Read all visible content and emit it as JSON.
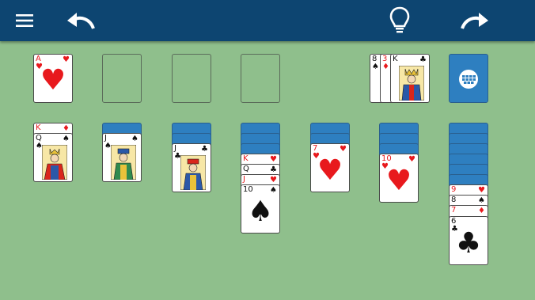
{
  "toolbar": {
    "background": "#0d4571",
    "buttons": [
      {
        "name": "menu",
        "icon": "hamburger-icon"
      },
      {
        "name": "undo",
        "icon": "undo-arrow-icon"
      },
      {
        "name": "hint",
        "icon": "lightbulb-icon"
      },
      {
        "name": "redo",
        "icon": "redo-arrow-icon"
      }
    ]
  },
  "table_background": "#8fbf8c",
  "foundations": [
    {
      "rank": "A",
      "suit": "♥",
      "color": "red"
    },
    {
      "empty": true
    },
    {
      "empty": true
    },
    {
      "empty": true
    }
  ],
  "waste": [
    {
      "rank": "8",
      "suit": "♠",
      "color": "black"
    },
    {
      "rank": "3",
      "suit": "♦",
      "color": "red"
    },
    {
      "rank": "K",
      "suit": "♣",
      "color": "black"
    }
  ],
  "stock": {
    "icon": "deck-dots-icon",
    "color": "#2e7fc0"
  },
  "tableau": [
    {
      "hidden": 0,
      "cards": [
        {
          "rank": "K",
          "suit": "♦"
        },
        {
          "rank": "Q",
          "suit": "♠"
        }
      ]
    },
    {
      "hidden": 1,
      "cards": [
        {
          "rank": "J",
          "suit": "♠"
        }
      ]
    },
    {
      "hidden": 2,
      "cards": [
        {
          "rank": "J",
          "suit": "♣"
        }
      ]
    },
    {
      "hidden": 3,
      "cards": [
        {
          "rank": "K",
          "suit": "♥"
        },
        {
          "rank": "Q",
          "suit": "♣"
        },
        {
          "rank": "J",
          "suit": "♥"
        },
        {
          "rank": "10",
          "suit": "♠"
        }
      ]
    },
    {
      "hidden": 2,
      "cards": [
        {
          "rank": "7",
          "suit": "♥"
        }
      ]
    },
    {
      "hidden": 3,
      "cards": [
        {
          "rank": "10",
          "suit": "♥"
        }
      ]
    },
    {
      "hidden": 6,
      "cards": [
        {
          "rank": "9",
          "suit": "♥"
        },
        {
          "rank": "8",
          "suit": "♠"
        },
        {
          "rank": "7",
          "suit": "♦"
        },
        {
          "rank": "6",
          "suit": "♣"
        }
      ]
    }
  ]
}
